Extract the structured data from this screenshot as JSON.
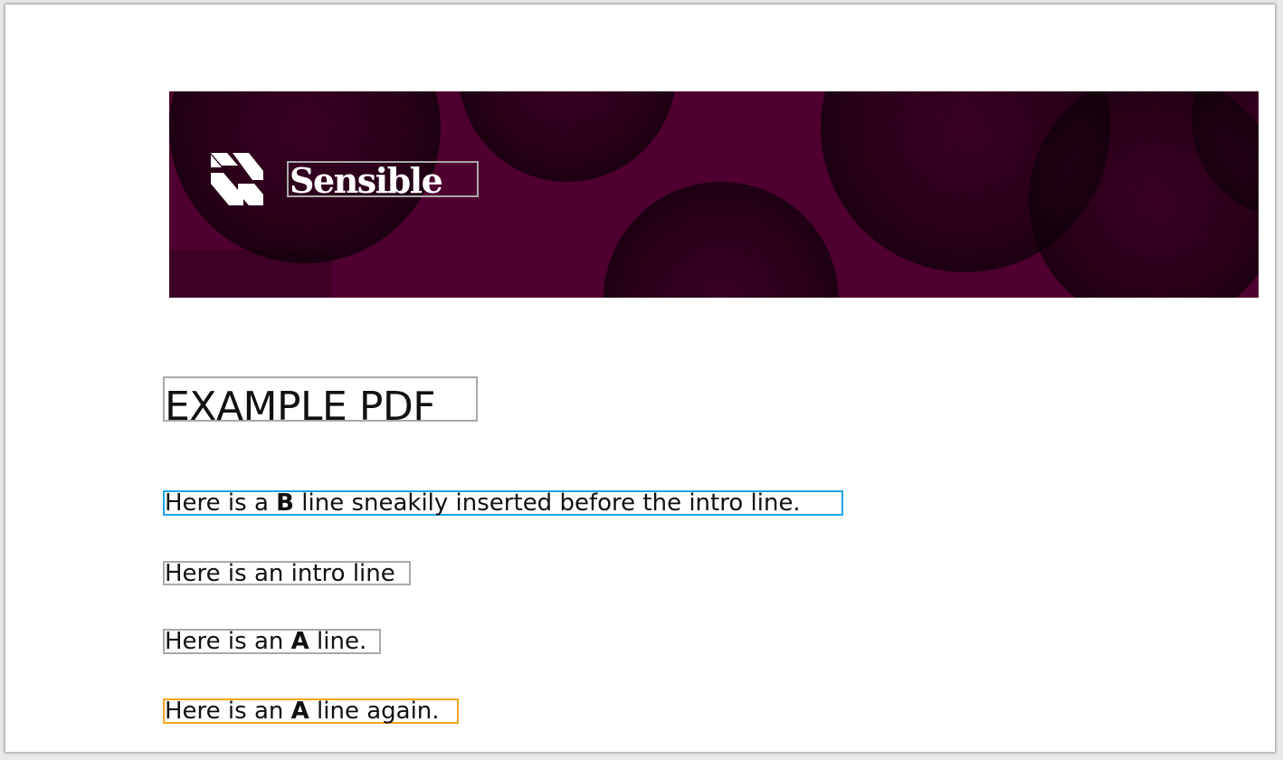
{
  "banner": {
    "brand_name": "Sensible",
    "background_color": "#4f0030",
    "logo_icon": "sensible-logo-icon"
  },
  "document": {
    "title": "EXAMPLE PDF",
    "lines": [
      {
        "prefix": "Here is a ",
        "bold": "B",
        "suffix": " line sneakily inserted before the intro line.",
        "highlight": "#1fa3ea"
      },
      {
        "prefix": "Here is an intro line",
        "bold": "",
        "suffix": "",
        "highlight": "#a9a9a9"
      },
      {
        "prefix": "Here is an ",
        "bold": "A",
        "suffix": " line.",
        "highlight": "#a9a9a9"
      },
      {
        "prefix": "Here is an ",
        "bold": "A",
        "suffix": " line again.",
        "highlight": "#f5a623"
      }
    ]
  }
}
